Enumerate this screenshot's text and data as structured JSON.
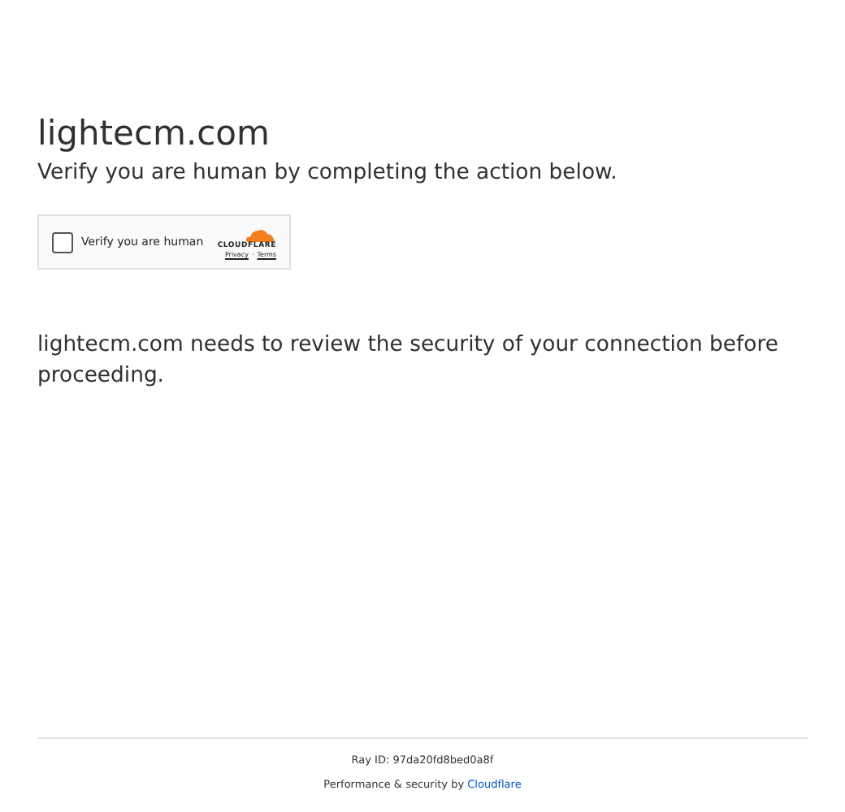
{
  "heading": "lightecm.com",
  "subtitle": "Verify you are human by completing the action below.",
  "widget": {
    "checkbox_label": "Verify you are human",
    "checked": false,
    "logo_text": "CLOUDFLARE",
    "links": [
      "Privacy",
      "Terms"
    ],
    "separator": "·"
  },
  "message": "lightecm.com needs to review the security of your connection before proceeding.",
  "footer": {
    "ray_id": "Ray ID: 97da20fd8bed0a8f",
    "performance_text": "Performance & security by",
    "performance_link": "Cloudflare"
  }
}
